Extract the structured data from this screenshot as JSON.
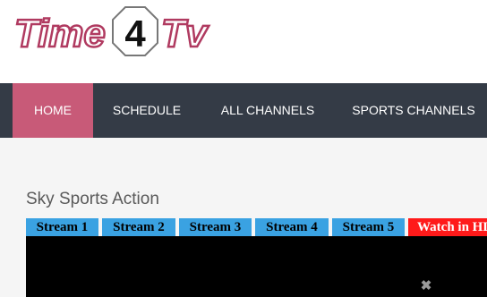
{
  "brand": {
    "logo_text": "Time4Tv",
    "logo_part1": "Time",
    "logo_part2": "4",
    "logo_part3": "Tv"
  },
  "nav": {
    "items": [
      {
        "label": "HOME",
        "active": true
      },
      {
        "label": "SCHEDULE",
        "active": false
      },
      {
        "label": "ALL CHANNELS",
        "active": false
      },
      {
        "label": "SPORTS CHANNELS",
        "active": false
      }
    ]
  },
  "page": {
    "title": "Sky Sports Action"
  },
  "streams": {
    "tabs": [
      {
        "label": "Stream 1"
      },
      {
        "label": "Stream 2"
      },
      {
        "label": "Stream 3"
      },
      {
        "label": "Stream 4"
      },
      {
        "label": "Stream 5"
      },
      {
        "label": "Watch in HD"
      }
    ]
  },
  "player": {
    "close_glyph": "✖"
  },
  "colors": {
    "nav_bg": "#343b46",
    "nav_active": "#c85a78",
    "tab": "#3aa2e2",
    "tab_hd": "#ff1a1a"
  }
}
